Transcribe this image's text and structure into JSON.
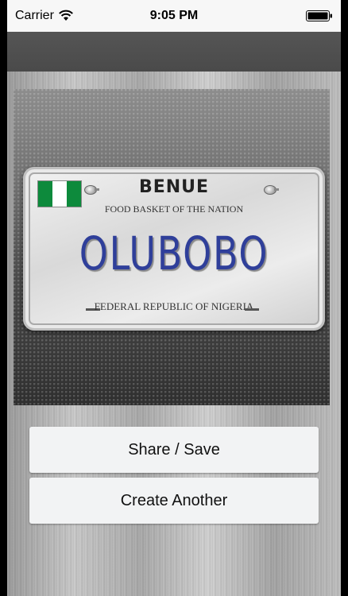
{
  "status_bar": {
    "carrier": "Carrier",
    "time": "9:05 PM"
  },
  "icons": {
    "wifi": "wifi-icon",
    "battery": "battery-icon"
  },
  "plate": {
    "state": "BENUE",
    "slogan": "FOOD BASKET OF THE NATION",
    "number": "OLUBOBO",
    "country": "FEDERAL REPUBLIC OF NIGERIA",
    "flag_colors": [
      "#0d8a3c",
      "#ffffff",
      "#0d8a3c"
    ],
    "number_color": "#2f3f9a"
  },
  "actions": {
    "share_label": "Share / Save",
    "create_label": "Create Another"
  }
}
